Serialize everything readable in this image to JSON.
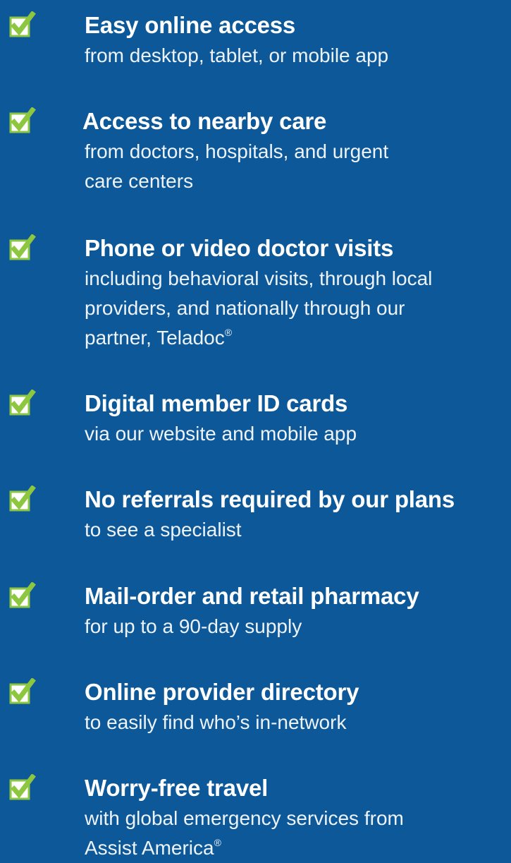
{
  "colors": {
    "background": "#0d5899",
    "check_green": "#8dc63f",
    "box_white": "#ffffff",
    "text": "#ffffff"
  },
  "benefits": [
    {
      "icon": "checkbox-checked-icon",
      "title": "Easy online access",
      "desc_lines": [
        "from desktop, tablet, or mobile app"
      ]
    },
    {
      "icon": "checkbox-checked-icon",
      "title": "Access to nearby care",
      "desc_lines": [
        "from doctors, hospitals, and urgent",
        "care centers"
      ]
    },
    {
      "icon": "checkbox-checked-icon",
      "title": "Phone or video doctor visits",
      "desc_lines": [
        "including behavioral visits, through local",
        "providers, and nationally through our",
        "partner, Teladoc"
      ],
      "desc_mark": "®"
    },
    {
      "icon": "checkbox-checked-icon",
      "title": "Digital member ID cards",
      "desc_lines": [
        "via our website and mobile app"
      ]
    },
    {
      "icon": "checkbox-checked-icon",
      "title": "No referrals required by our plans",
      "desc_lines": [
        "to see a specialist"
      ]
    },
    {
      "icon": "checkbox-checked-icon",
      "title": "Mail-order and retail pharmacy",
      "desc_lines": [
        "for up to a 90-day supply"
      ]
    },
    {
      "icon": "checkbox-checked-icon",
      "title": "Online provider directory",
      "desc_lines": [
        "to easily find who’s in-network"
      ]
    },
    {
      "icon": "checkbox-checked-icon",
      "title": "Worry-free travel",
      "desc_lines": [
        "with global emergency services from",
        "Assist America"
      ],
      "desc_mark": "®"
    }
  ]
}
